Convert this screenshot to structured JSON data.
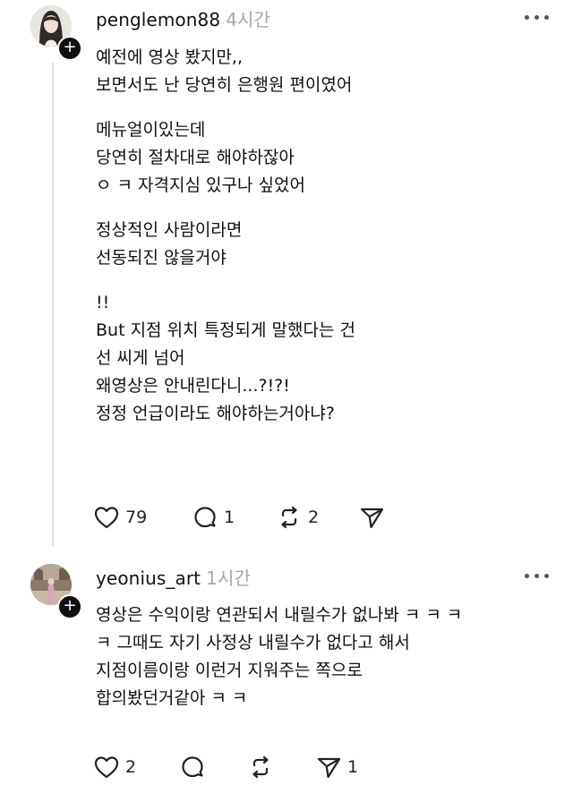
{
  "posts": [
    {
      "username": "penglemon88",
      "time": "4시간",
      "follow_symbol": "+",
      "lines": [
        "예전에 영상 봤지만,,",
        "보면서도 난 당연히 은행원 편이였어",
        "",
        "메뉴얼이있는데",
        "당연히 절차대로 해야하잖아",
        "ㅇ ㅋ 자격지심 있구나 싶었어",
        "",
        "정상적인 사람이라면",
        "선동되진 않을거야",
        "",
        "!!",
        "But 지점 위치 특정되게 말했다는 건",
        "선 씨게 넘어",
        "왜영상은 안내린다니...?!?!",
        "정정 언급이라도 해야하는거아냐?"
      ],
      "likes": "79",
      "replies": "1",
      "reposts": "2",
      "shares": ""
    },
    {
      "username": "yeonius_art",
      "time": "1시간",
      "follow_symbol": "+",
      "lines": [
        "영상은 수익이랑 연관되서 내릴수가 없나봐 ㅋ ㅋ ㅋ",
        "ㅋ 그때도 자기 사정상 내릴수가 없다고 해서",
        "지점이름이랑 이런거 지워주는 쪽으로",
        "합의봤던거같아 ㅋ ㅋ"
      ],
      "likes": "2",
      "replies": "",
      "reposts": "",
      "shares": "1"
    }
  ],
  "icons": {
    "like": "heart-icon",
    "reply": "comment-icon",
    "repost": "repost-icon",
    "share": "send-icon",
    "more": "more-icon"
  }
}
